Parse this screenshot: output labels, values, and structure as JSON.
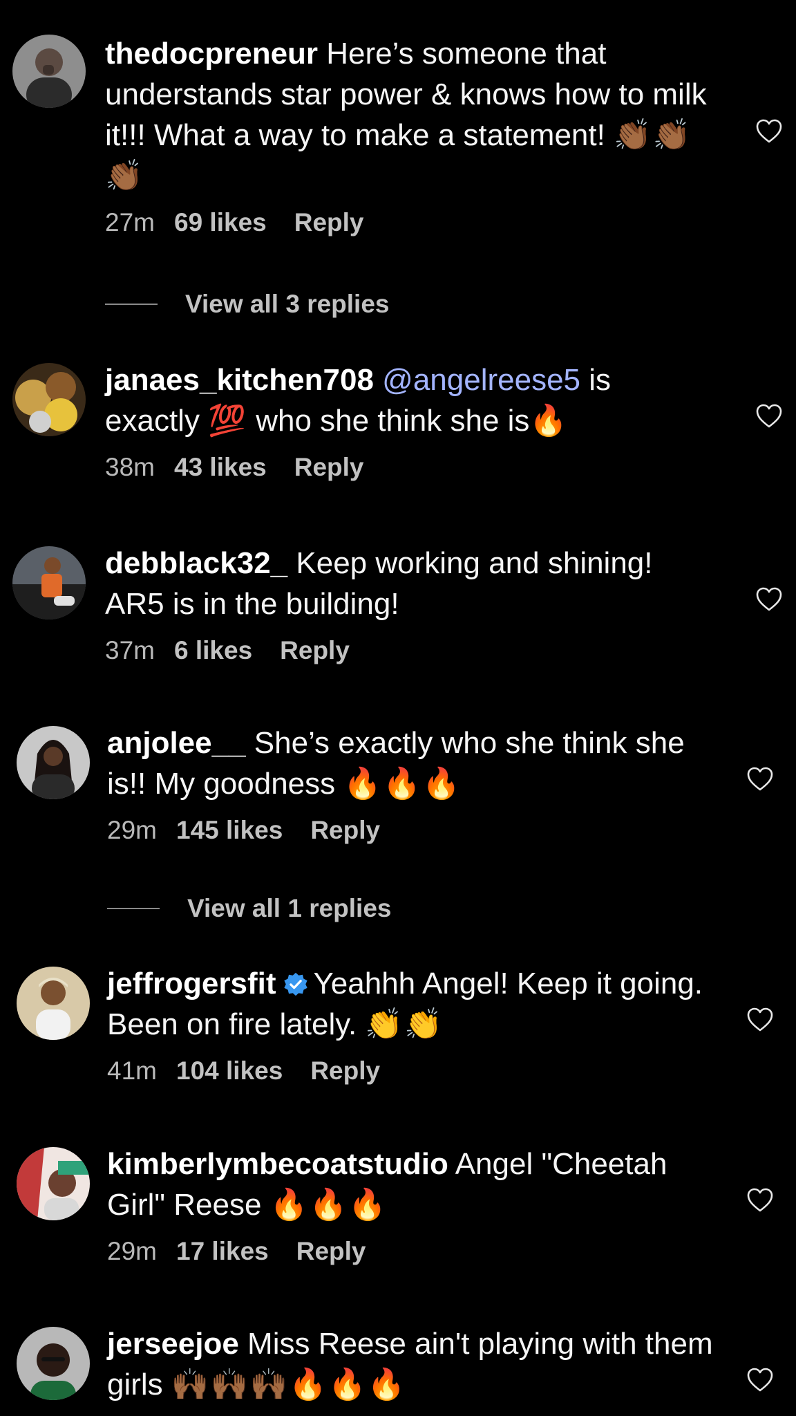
{
  "comments": [
    {
      "username": "thedocpreneur",
      "text": " Here’s someone that understands star power & knows how to milk it!!! What a way to make a statement! ",
      "emojis": "👏🏾👏🏾👏🏾",
      "time": "27m",
      "likes": "69 likes",
      "reply": "Reply"
    },
    {
      "username": "janaes_kitchen708",
      "mention": "@angelreese5",
      "text_before": " ",
      "text": " is exactly ",
      "emoji_mid": "💯",
      "text_after": " who she think she is",
      "emojis": "🔥",
      "time": "38m",
      "likes": "43 likes",
      "reply": "Reply"
    },
    {
      "username": "debblack32_",
      "text": " Keep working and shining! AR5 is in the building!",
      "time": "37m",
      "likes": "6 likes",
      "reply": "Reply"
    },
    {
      "username": "anjolee__",
      "text": " She’s exactly who she think she is!! My goodness ",
      "emojis": "🔥🔥🔥",
      "time": "29m",
      "likes": "145 likes",
      "reply": "Reply"
    },
    {
      "username": "jeffrogersfit",
      "text": "Yeahhh Angel! Keep it going. Been on fire lately. ",
      "emojis": "👏👏",
      "time": "41m",
      "likes": "104 likes",
      "reply": "Reply"
    },
    {
      "username": "kimberlymbecoatstudio",
      "text": " Angel \"Cheetah Girl\" Reese ",
      "emojis": "🔥🔥🔥",
      "time": "29m",
      "likes": "17 likes",
      "reply": "Reply"
    },
    {
      "username": "jerseejoe",
      "text": " Miss Reese ain't playing with them girls ",
      "emojis": "🙌🏾🙌🏾🙌🏾🔥🔥🔥"
    }
  ],
  "view_replies": [
    "View all 3 replies",
    "View all 1 replies"
  ],
  "colors": {
    "background": "#000000",
    "text": "#f5f5f5",
    "meta": "#b9b9b9",
    "mention": "#a3b4ff",
    "verified": "#3897f0"
  },
  "icons": {
    "like": "heart-outline-icon",
    "verified": "verified-badge-icon"
  }
}
